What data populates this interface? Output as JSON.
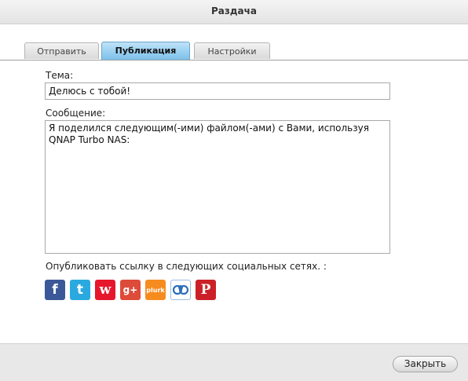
{
  "dialog": {
    "title": "Раздача"
  },
  "tabs": [
    {
      "label": "Отправить",
      "active": false
    },
    {
      "label": "Публикация",
      "active": true
    },
    {
      "label": "Настройки",
      "active": false
    }
  ],
  "form": {
    "subject_label": "Тема:",
    "subject_value": "Делюсь с тобой!",
    "message_label": "Сообщение:",
    "message_value": "Я поделился следующим(-ими) файлом(-ами) с Вами, используя QNAP Turbo NAS:",
    "social_label": "Опубликовать ссылку в следующих социальных сетях. :"
  },
  "social_networks": [
    {
      "icon": "facebook-icon",
      "glyph": "f",
      "color": "#3b5998"
    },
    {
      "icon": "twitter-icon",
      "glyph": "t",
      "color": "#2aa9e0"
    },
    {
      "icon": "weibo-icon",
      "glyph": "w",
      "color": "#e6162d"
    },
    {
      "icon": "google-plus-icon",
      "glyph": "g+",
      "color": "#dd4b39"
    },
    {
      "icon": "plurk-icon",
      "glyph": "plurk",
      "color": "#f68b1f"
    },
    {
      "icon": "qzone-icon",
      "glyph": "",
      "color": "#2c6fb7"
    },
    {
      "icon": "pinterest-icon",
      "glyph": "P",
      "color": "#cb2027"
    }
  ],
  "footer": {
    "close_label": "Закрыть"
  }
}
